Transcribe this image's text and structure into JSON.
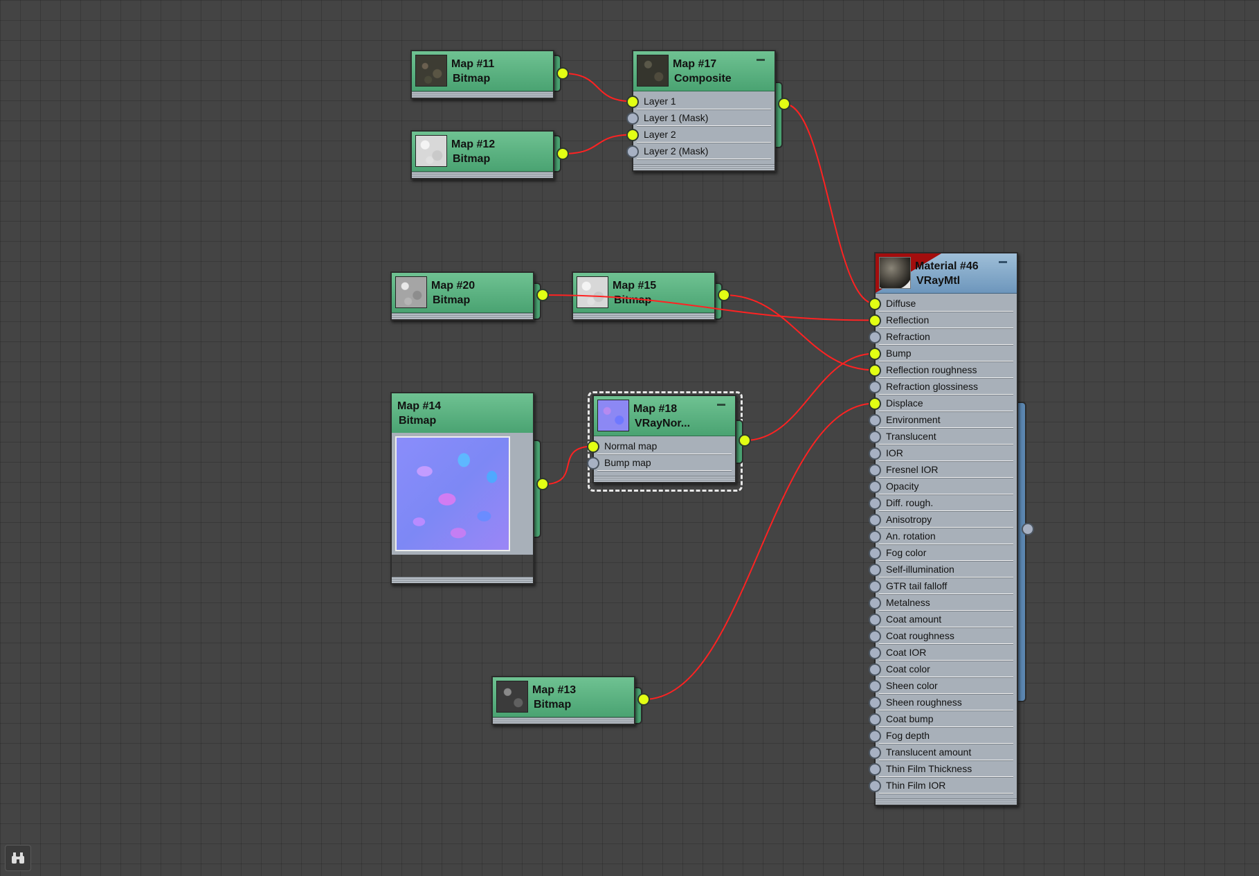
{
  "nodes": {
    "map11": {
      "name": "Map #11",
      "type": "Bitmap"
    },
    "map12": {
      "name": "Map #12",
      "type": "Bitmap"
    },
    "map17": {
      "name": "Map #17",
      "type": "Composite",
      "params": [
        "Layer 1",
        "Layer 1 (Mask)",
        "Layer 2",
        "Layer 2 (Mask)"
      ]
    },
    "map20": {
      "name": "Map #20",
      "type": "Bitmap"
    },
    "map15": {
      "name": "Map #15",
      "type": "Bitmap"
    },
    "map14": {
      "name": "Map #14",
      "type": "Bitmap"
    },
    "map18": {
      "name": "Map #18",
      "type": "VRayNor...",
      "params": [
        "Normal map",
        "Bump map"
      ]
    },
    "map13": {
      "name": "Map #13",
      "type": "Bitmap"
    },
    "material46": {
      "name": "Material #46",
      "type": "VRayMtl",
      "params": [
        "Diffuse",
        "Reflection",
        "Refraction",
        "Bump",
        "Reflection roughness",
        "Refraction glossiness",
        "Displace",
        "Environment",
        "Translucent",
        "IOR",
        "Fresnel IOR",
        "Opacity",
        "Diff. rough.",
        "Anisotropy",
        "An. rotation",
        "Fog color",
        "Self-illumination",
        "GTR tail falloff",
        "Metalness",
        "Coat amount",
        "Coat roughness",
        "Coat IOR",
        "Coat color",
        "Sheen color",
        "Sheen roughness",
        "Coat bump",
        "Fog depth",
        "Translucent amount",
        "Thin Film Thickness",
        "Thin Film IOR"
      ]
    }
  },
  "connected_slots": {
    "map17": [
      "Layer 1",
      "Layer 2"
    ],
    "map18": [
      "Normal map"
    ],
    "material46": [
      "Diffuse",
      "Reflection",
      "Bump",
      "Reflection roughness",
      "Displace"
    ]
  },
  "connections": [
    {
      "from": "Map #11",
      "to": "Map #17 / Layer 1"
    },
    {
      "from": "Map #12",
      "to": "Map #17 / Layer 2"
    },
    {
      "from": "Map #17",
      "to": "Material #46 / Diffuse"
    },
    {
      "from": "Map #20",
      "to": "Material #46 / Reflection"
    },
    {
      "from": "Map #15",
      "to": "Material #46 / Reflection roughness"
    },
    {
      "from": "Map #14",
      "to": "Map #18 / Normal map"
    },
    {
      "from": "Map #18",
      "to": "Material #46 / Bump"
    },
    {
      "from": "Map #13",
      "to": "Material #46 / Displace"
    }
  ],
  "selected_node": "Map #18",
  "colors": {
    "background": "#444444",
    "map_header": "#4aa372",
    "material_header": "#6d96bc",
    "material_badge": "#a30d0d",
    "param_panel": "#a8b0b9",
    "socket_connected": "#e2ff14",
    "socket_empty": "#a7b1c3",
    "wire": "#ff2222"
  },
  "icons": {
    "find_button": "binoculars-icon"
  }
}
